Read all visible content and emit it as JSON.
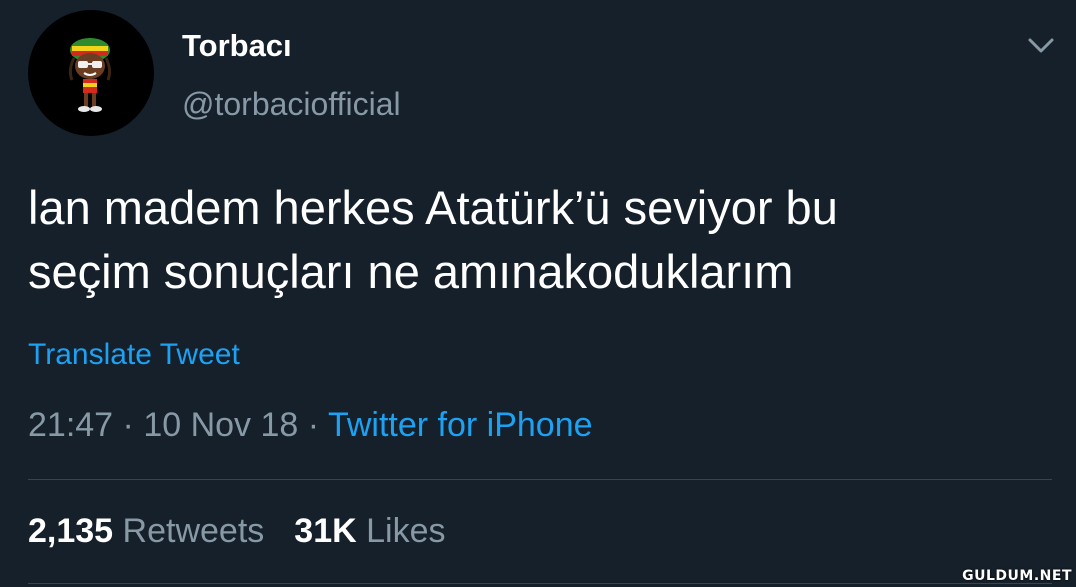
{
  "profile": {
    "name": "Torbacı",
    "handle": "@torbaciofficial",
    "avatar_icon": "rasta-character-avatar"
  },
  "menu": {
    "icon": "chevron-down-icon"
  },
  "tweet": {
    "line1": "lan madem herkes Atatürk’ü seviyor bu",
    "line2": "seçim sonuçları ne amınakoduklarım",
    "translate_label": "Translate Tweet",
    "time": "21:47",
    "separator": "·",
    "date": "10 Nov 18",
    "source": "Twitter for iPhone"
  },
  "stats": {
    "retweets_count": "2,135",
    "retweets_label": "Retweets",
    "likes_count": "31K",
    "likes_label": "Likes"
  },
  "watermark": "GULDUM.NET",
  "colors": {
    "background": "#15202b",
    "accent": "#1da1f2",
    "secondary_text": "#8899a6"
  }
}
